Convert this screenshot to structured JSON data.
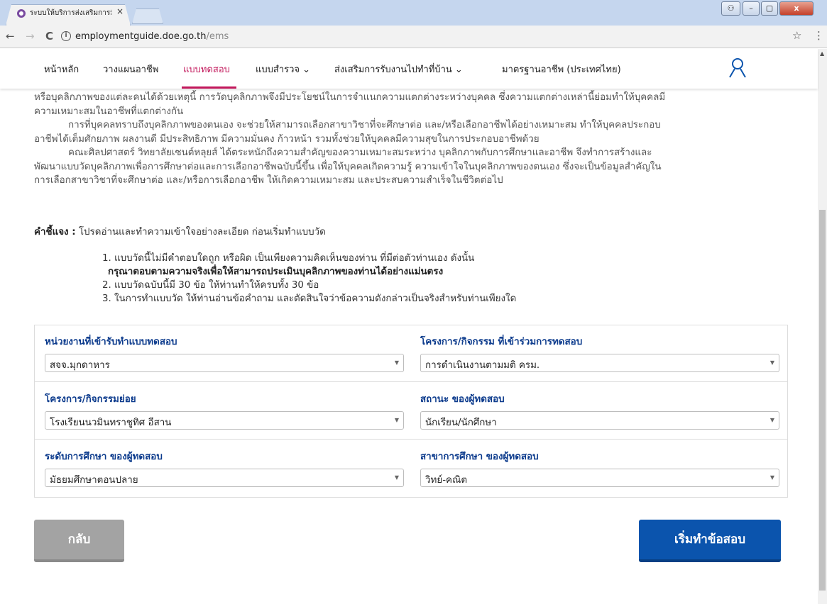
{
  "browser": {
    "tab_title": "ระบบให้บริการส่งเสริมการมี",
    "tab_close": "×",
    "url_host": "employmentguide.doe.go.th",
    "url_path": "/ems",
    "back": "←",
    "forward": "→",
    "reload": "C",
    "info": "i",
    "star": "☆",
    "menu": "⋮",
    "win_min": "–",
    "win_max": "▢",
    "win_close": "x",
    "win_user": "⚇"
  },
  "nav": {
    "items": [
      {
        "label": "หน้าหลัก"
      },
      {
        "label": "วางแผนอาชีพ"
      },
      {
        "label": "แบบทดสอบ"
      },
      {
        "label": "แบบสำรวจ ⌄"
      },
      {
        "label": "ส่งเสริมการรับงานไปทำที่บ้าน ⌄"
      },
      {
        "label": "มาตรฐานอาชีพ (ประเทศไทย)"
      }
    ]
  },
  "intro": {
    "line1": "หรือบุคลิกภาพของแต่ละคนได้ด้วยเหตุนี้ การวัดบุคลิกภาพจึงมีประโยชน์ในการจำแนกความแตกต่างระหว่างบุคคล ซึ่งความแตกต่างเหล่านี้ย่อมทำให้บุคคลมี",
    "line2": "ความเหมาะสมในอาชีพที่แตกต่างกัน",
    "line3": "การที่บุคคลทราบถึงบุคลิกภาพของตนเอง จะช่วยให้สามารถเลือกสาขาวิชาที่จะศึกษาต่อ และ/หรือเลือกอาชีพได้อย่างเหมาะสม ทำให้บุคคลประกอบ",
    "line4": "อาชีพได้เต็มศักยภาพ ผลงานดี มีประสิทธิภาพ มีความมั่นคง ก้าวหน้า รวมทั้งช่วยให้บุคคลมีความสุขในการประกอบอาชีพด้วย",
    "line5": "คณะศิลปศาสตร์ วิทยาลัยเซนต์หลุยส์ ได้ตระหนักถึงความสำคัญของความเหมาะสมระหว่าง บุคลิกภาพกับการศึกษาและอาชีพ จึงทำการสร้างและ",
    "line6": "พัฒนาแบบวัดบุคลิกภาพเพื่อการศึกษาต่อและการเลือกอาชีพฉบับนี้ขึ้น เพื่อให้บุคคลเกิดความรู้ ความเข้าใจในบุคลิกภาพของตนเอง ซึ่งจะเป็นข้อมูลสำคัญใน",
    "line7": "การเลือกสาขาวิชาที่จะศึกษาต่อ และ/หรือการเลือกอาชีพ ให้เกิดความเหมาะสม และประสบความสำเร็จในชีวิตต่อไป"
  },
  "instructions": {
    "label": "คำชี้แจง :",
    "text": " โปรดอ่านและทำความเข้าใจอย่างละเอียด ก่อนเริ่มทำแบบวัด",
    "item1": "1. แบบวัดนี้ไม่มีคำตอบใดถูก หรือผิด เป็นเพียงความคิดเห็นของท่าน ที่มีต่อตัวท่านเอง ดังนั้น",
    "item1_bold": "กรุณาตอบตามความจริงเพื่อให้สามารถประเมินบุคลิกภาพของท่านได้อย่างแม่นตรง",
    "item2": "2. แบบวัดฉบับนี้มี 30 ข้อ ให้ท่านทำให้ครบทั้ง 30 ข้อ",
    "item3": "3. ในการทำแบบวัด ให้ท่านอ่านข้อคำถาม และตัดสินใจว่าข้อความดังกล่าวเป็นจริงสำหรับท่านเพียงใด"
  },
  "form": {
    "agency_label": "หน่วยงานที่เข้ารับทำแบบทดสอบ",
    "agency_value": "สจจ.มุกดาหาร",
    "project_label": "โครงการ/กิจกรรม ที่เข้าร่วมการทดสอบ",
    "project_value": "การดำเนินงานตามมติ ครม.",
    "subproject_label": "โครงการ/กิจกรรมย่อย",
    "subproject_value": "โรงเรียนนวมินทราชูทิศ อีสาน",
    "status_label": "สถานะ ของผู้ทดสอบ",
    "status_value": "นักเรียน/นักศึกษา",
    "edu_level_label": "ระดับการศึกษา ของผู้ทดสอบ",
    "edu_level_value": "มัธยมศึกษาตอนปลาย",
    "edu_field_label": "สาขาการศึกษา ของผู้ทดสอบ",
    "edu_field_value": "วิทย์-คณิต",
    "caret": "▼"
  },
  "buttons": {
    "back": "กลับ",
    "start": "เริ่มทำข้อสอบ"
  },
  "colors": {
    "active_nav": "#c2185b",
    "label_blue": "#0b3a8c",
    "start_button": "#0b54ad",
    "back_button": "#a3a3a3"
  }
}
